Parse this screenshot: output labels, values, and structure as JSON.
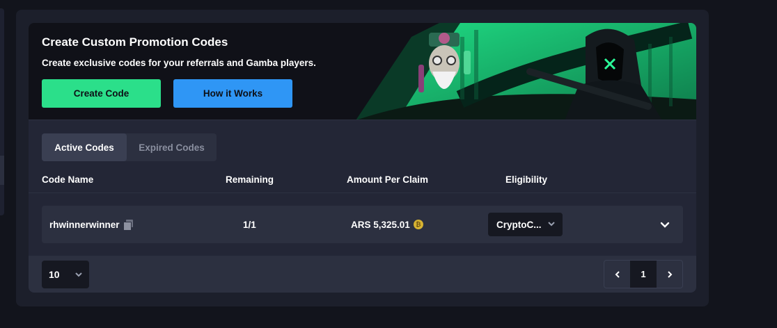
{
  "banner": {
    "title": "Create Custom Promotion Codes",
    "subtitle": "Create exclusive codes for your referrals and Gamba players.",
    "create_button": "Create Code",
    "how_button": "How it Works"
  },
  "tabs": [
    {
      "label": "Active Codes",
      "active": true
    },
    {
      "label": "Expired Codes",
      "active": false
    }
  ],
  "table": {
    "columns": [
      "Code Name",
      "Remaining",
      "Amount Per Claim",
      "Eligibility"
    ],
    "rows": [
      {
        "code_name": "rhwinnerwinner",
        "remaining": "1/1",
        "amount": "ARS 5,325.01",
        "eligibility": "CryptoC..."
      }
    ]
  },
  "pagination": {
    "per_page": "10",
    "current_page": "1"
  },
  "colors": {
    "accent_green": "#2bdf8a",
    "accent_blue": "#2f96f5",
    "coin": "#d6b232"
  },
  "icons": {
    "copy": "copy-icon",
    "coin": "coin-icon",
    "chevron": "chevron-down-icon",
    "prev": "chevron-left-icon",
    "next": "chevron-right-icon"
  }
}
